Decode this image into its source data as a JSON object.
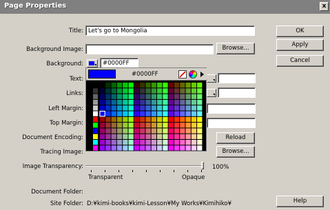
{
  "window": {
    "title": "Page Properties",
    "close_label": "x"
  },
  "fields": {
    "title": {
      "label": "Title:",
      "value": "Let's go to Mongolia"
    },
    "background_image": {
      "label": "Background Image:",
      "value": ""
    },
    "background": {
      "label": "Background:",
      "value": "#0000FF"
    },
    "text": {
      "label": "Text:"
    },
    "links": {
      "label": "Links:"
    },
    "left_margin": {
      "label": "Left Margin:"
    },
    "top_margin": {
      "label": "Top Margin:"
    },
    "document_encoding": {
      "label": "Document Encoding:"
    },
    "tracing_image": {
      "label": "Tracing Image:"
    },
    "image_transparency": {
      "label": "Image Transparency:",
      "value": "100%",
      "min_label": "Transparent",
      "max_label": "Opaque"
    },
    "document_folder": {
      "label": "Document Folder:",
      "value": ""
    },
    "site_folder": {
      "label": "Site Folder:",
      "value": "D:¥kimi-books¥kimi-Lesson¥My Works¥Kimihiko¥"
    }
  },
  "buttons": {
    "ok": "OK",
    "apply": "Apply",
    "cancel": "Cancel",
    "browse": "Browse...",
    "reload": "Reload",
    "browse2": "Browse...",
    "help": "Help"
  },
  "color_picker": {
    "hex": "#0000FF",
    "selected_color": "#0000ff",
    "icons": [
      "no-color-icon",
      "system-color-picker-icon",
      "palette-menu-arrow-icon"
    ]
  },
  "colors": {
    "titlebar": "#808080",
    "dialog": "#d4d0c8"
  }
}
